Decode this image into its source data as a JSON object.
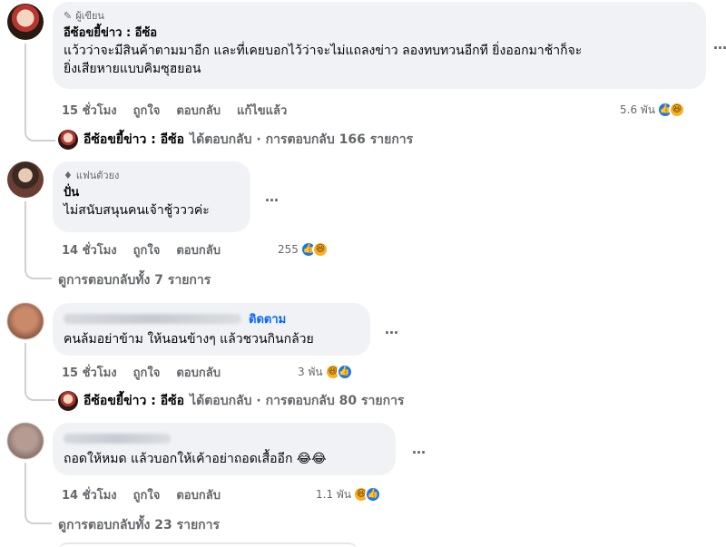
{
  "comments": [
    {
      "badge": "ผู้เขียน",
      "author": "อีซ้อขยี้ข่าว : อีซ้อ",
      "text": "แว้วว่าจะมีสินค้าตามมาอีก และที่เคยบอกไว้ว่าจะไม่แถลงข่าว ลองทบทวนอีกที ยิ่งออกมาช้าก็จะ\nยิ่งเสียหายแบบคิมซุฮยอน",
      "time": "15 ชั่วโมง",
      "like": "ถูกใจ",
      "reply": "ตอบกลับ",
      "edited": "แก้ไขแล้ว",
      "reaction_count": "5.6 พัน",
      "reply_summary": {
        "name": "อีซ้อขยี้ข่าว : อีซ้อ",
        "text": "ได้ตอบกลับ · การตอบกลับ 166 รายการ"
      }
    },
    {
      "badge": "แฟนตัวยง",
      "author": "ปั่น",
      "text": "ไม่สนับสนุนคนเจ้าชู้วววค่ะ",
      "time": "14 ชั่วโมง",
      "like": "ถูกใจ",
      "reply": "ตอบกลับ",
      "reaction_count": "255",
      "more_replies": "ดูการตอบกลับทั้ง 7 รายการ"
    },
    {
      "follow": "ติดตาม",
      "text": "คนล้มอย่าข้าม ให้นอนข้างๆ แล้วชวนกินกล้วย",
      "time": "15 ชั่วโมง",
      "like": "ถูกใจ",
      "reply": "ตอบกลับ",
      "reaction_count": "3 พัน",
      "reply_summary": {
        "name": "อีซ้อขยี้ข่าว : อีซ้อ",
        "text": "ได้ตอบกลับ · การตอบกลับ 80 รายการ"
      }
    },
    {
      "text": "ถอดให้หมด แล้วบอกให้เค้าอย่าถอดเสื้ออีก 😂😂",
      "time": "14 ชั่วโมง",
      "like": "ถูกใจ",
      "reply": "ตอบกลับ",
      "reaction_count": "1.1 พัน",
      "more_replies": "ดูการตอบกลับทั้ง 23 รายการ"
    }
  ],
  "more_icon": "…",
  "reaction_icons": [
    "like-icon",
    "haha-icon"
  ]
}
